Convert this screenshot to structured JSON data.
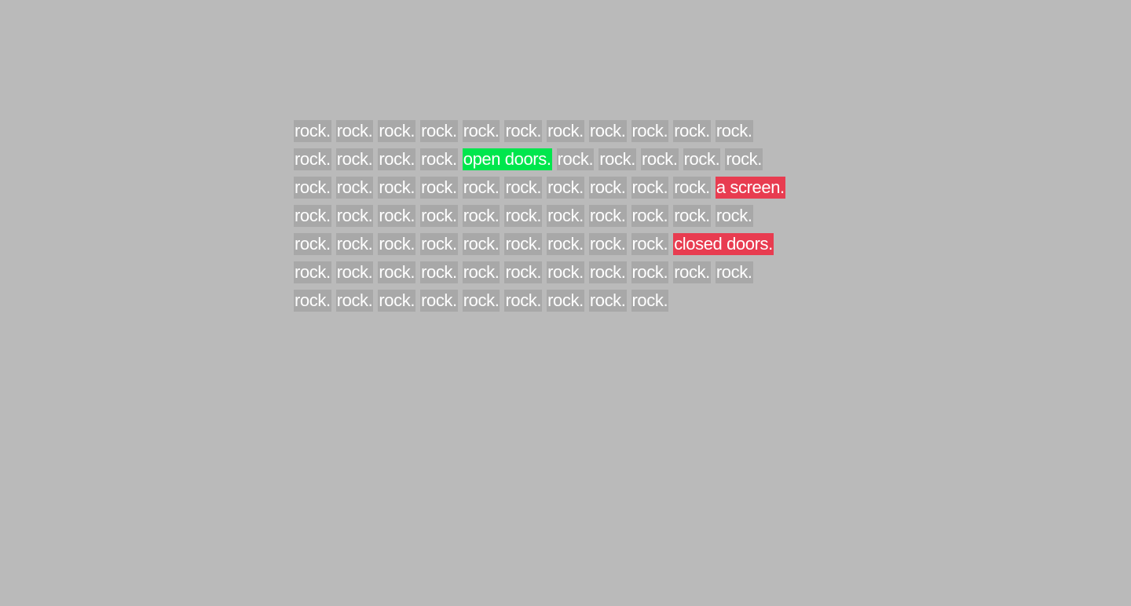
{
  "colors": {
    "background": "#bababa",
    "word_bg": "#a8a8a8",
    "text": "#ffffff",
    "open": "#00e64d",
    "closed": "#e83c50"
  },
  "rows": [
    [
      {
        "text": "rock.",
        "kind": "rock"
      },
      {
        "text": "rock.",
        "kind": "rock"
      },
      {
        "text": "rock.",
        "kind": "rock"
      },
      {
        "text": "rock.",
        "kind": "rock"
      },
      {
        "text": "rock.",
        "kind": "rock"
      },
      {
        "text": "rock.",
        "kind": "rock"
      },
      {
        "text": "rock.",
        "kind": "rock"
      },
      {
        "text": "rock.",
        "kind": "rock"
      },
      {
        "text": "rock.",
        "kind": "rock"
      },
      {
        "text": "rock.",
        "kind": "rock"
      },
      {
        "text": "rock.",
        "kind": "rock"
      }
    ],
    [
      {
        "text": "rock.",
        "kind": "rock"
      },
      {
        "text": "rock.",
        "kind": "rock"
      },
      {
        "text": "rock.",
        "kind": "rock"
      },
      {
        "text": "rock.",
        "kind": "rock"
      },
      {
        "text": "open doors.",
        "kind": "open"
      },
      {
        "text": "rock.",
        "kind": "rock"
      },
      {
        "text": "rock.",
        "kind": "rock"
      },
      {
        "text": "rock.",
        "kind": "rock"
      },
      {
        "text": "rock.",
        "kind": "rock"
      },
      {
        "text": "rock.",
        "kind": "rock"
      }
    ],
    [
      {
        "text": "rock.",
        "kind": "rock"
      },
      {
        "text": "rock.",
        "kind": "rock"
      },
      {
        "text": "rock.",
        "kind": "rock"
      },
      {
        "text": "rock.",
        "kind": "rock"
      },
      {
        "text": "rock.",
        "kind": "rock"
      },
      {
        "text": "rock.",
        "kind": "rock"
      },
      {
        "text": "rock.",
        "kind": "rock"
      },
      {
        "text": "rock.",
        "kind": "rock"
      },
      {
        "text": "rock.",
        "kind": "rock"
      },
      {
        "text": "rock.",
        "kind": "rock"
      },
      {
        "text": "a screen.",
        "kind": "closed"
      }
    ],
    [
      {
        "text": "rock.",
        "kind": "rock"
      },
      {
        "text": "rock.",
        "kind": "rock"
      },
      {
        "text": "rock.",
        "kind": "rock"
      },
      {
        "text": "rock.",
        "kind": "rock"
      },
      {
        "text": "rock.",
        "kind": "rock"
      },
      {
        "text": "rock.",
        "kind": "rock"
      },
      {
        "text": "rock.",
        "kind": "rock"
      },
      {
        "text": "rock.",
        "kind": "rock"
      },
      {
        "text": "rock.",
        "kind": "rock"
      },
      {
        "text": "rock.",
        "kind": "rock"
      },
      {
        "text": "rock.",
        "kind": "rock"
      }
    ],
    [
      {
        "text": "rock.",
        "kind": "rock"
      },
      {
        "text": "rock.",
        "kind": "rock"
      },
      {
        "text": "rock.",
        "kind": "rock"
      },
      {
        "text": "rock.",
        "kind": "rock"
      },
      {
        "text": "rock.",
        "kind": "rock"
      },
      {
        "text": "rock.",
        "kind": "rock"
      },
      {
        "text": "rock.",
        "kind": "rock"
      },
      {
        "text": "rock.",
        "kind": "rock"
      },
      {
        "text": "rock.",
        "kind": "rock"
      },
      {
        "text": "closed doors.",
        "kind": "closed"
      }
    ],
    [
      {
        "text": "rock.",
        "kind": "rock"
      },
      {
        "text": "rock.",
        "kind": "rock"
      },
      {
        "text": "rock.",
        "kind": "rock"
      },
      {
        "text": "rock.",
        "kind": "rock"
      },
      {
        "text": "rock.",
        "kind": "rock"
      },
      {
        "text": "rock.",
        "kind": "rock"
      },
      {
        "text": "rock.",
        "kind": "rock"
      },
      {
        "text": "rock.",
        "kind": "rock"
      },
      {
        "text": "rock.",
        "kind": "rock"
      },
      {
        "text": "rock.",
        "kind": "rock"
      },
      {
        "text": "rock.",
        "kind": "rock"
      }
    ],
    [
      {
        "text": "rock.",
        "kind": "rock"
      },
      {
        "text": "rock.",
        "kind": "rock"
      },
      {
        "text": "rock.",
        "kind": "rock"
      },
      {
        "text": "rock.",
        "kind": "rock"
      },
      {
        "text": "rock.",
        "kind": "rock"
      },
      {
        "text": "rock.",
        "kind": "rock"
      },
      {
        "text": "rock.",
        "kind": "rock"
      },
      {
        "text": "rock.",
        "kind": "rock"
      },
      {
        "text": "rock.",
        "kind": "rock"
      }
    ]
  ]
}
